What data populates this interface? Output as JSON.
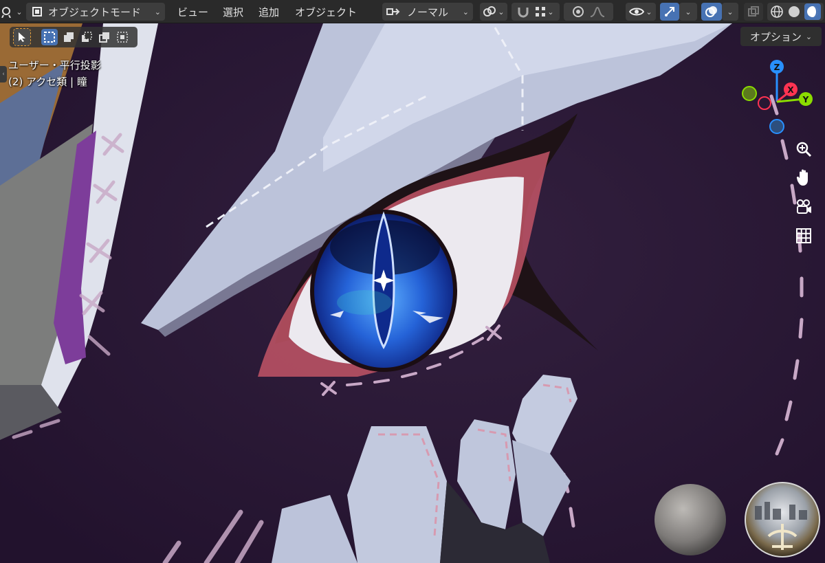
{
  "header": {
    "mode_label": "オブジェクトモード",
    "menu": [
      "ビュー",
      "選択",
      "追加",
      "オブジェクト"
    ],
    "orientation_label": "ノーマル"
  },
  "viewport": {
    "view_name": "ユーザー・平行投影",
    "object_info": "(2) アクセ類 | 瞳",
    "options_label": "オプション"
  },
  "gizmo": {
    "z_label": "Z",
    "x_label": "X",
    "y_label": "Y"
  },
  "colors": {
    "accent": "#4772b3",
    "axis_x": "#ff3352",
    "axis_y": "#8bdc00",
    "axis_z": "#2890ff",
    "skin": "#2b1838",
    "teeth": "#c5cbe0",
    "stitch": "#c9a8c8",
    "iris": "#1a48c2"
  },
  "icons": {
    "editor_type": "view3d-icon",
    "mode": "object-mode-icon",
    "zoom": "magnify-plus-icon",
    "pan": "hand-icon",
    "camera": "camera-icon",
    "grid": "grid-icon"
  }
}
